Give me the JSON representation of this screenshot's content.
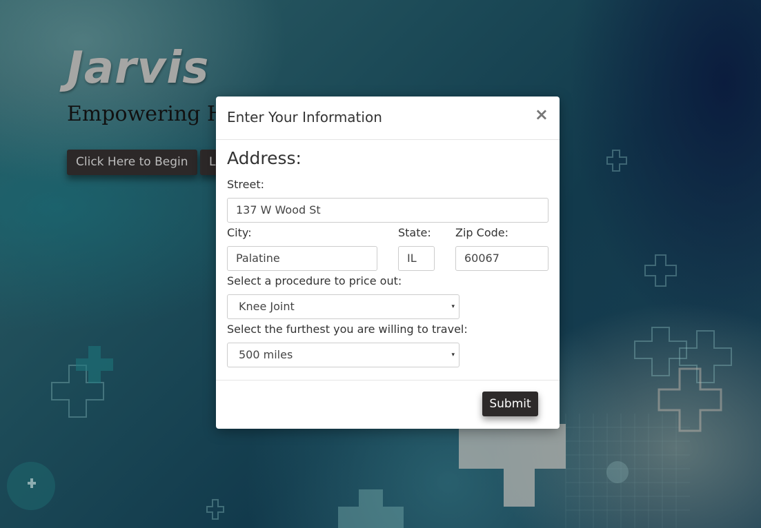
{
  "hero": {
    "brand": "Jarvis",
    "tagline": "Empowering He",
    "begin_button": "Click Here to Begin",
    "second_button": "L"
  },
  "modal": {
    "title": "Enter Your Information",
    "close_glyph": "×",
    "section_title": "Address:",
    "street": {
      "label": "Street:",
      "value": "137 W Wood St"
    },
    "city": {
      "label": "City:",
      "value": "Palatine"
    },
    "state": {
      "label": "State:",
      "value": "IL"
    },
    "zip": {
      "label": "Zip Code:",
      "value": "60067"
    },
    "procedure": {
      "label": "Select a procedure to price out:",
      "selected": "Knee Joint"
    },
    "distance": {
      "label": "Select the furthest you are willing to travel:",
      "selected": "500 miles"
    },
    "submit_label": "Submit",
    "caret_glyph": "▾"
  },
  "colors": {
    "brand_gray": "#a6a6a4",
    "button_dark": "#2c2828",
    "modal_bg": "#ffffff"
  },
  "icons": [
    "close-icon",
    "dropdown-caret-icon",
    "medical-cross-icon"
  ]
}
